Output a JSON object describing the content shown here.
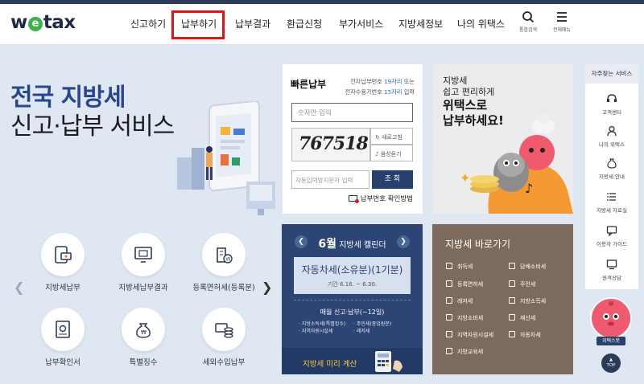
{
  "brand": {
    "logo_w": "w",
    "logo_e": "e",
    "logo_rest": "tax"
  },
  "nav": [
    "신고하기",
    "납부하기",
    "납부결과",
    "환급신청",
    "부가서비스",
    "지방세정보",
    "나의 위택스"
  ],
  "header_icons": {
    "search": "통합검색",
    "menu": "전체메뉴"
  },
  "hero": {
    "line1": "전국 지방세",
    "line2": "신고·납부 서비스"
  },
  "quick_buttons": [
    "지방세납부",
    "지방세납부결과",
    "등록면허세(등록분)",
    "납부확인서",
    "특별징수",
    "세외수입납부"
  ],
  "quick_pay": {
    "title": "빠른납부",
    "desc1_pre": "전자납부번호 ",
    "desc1_hl": "19자리",
    "desc1_post": " 또는",
    "desc2_pre": "전자수용가번호 ",
    "desc2_hl": "15자리",
    "desc2_post": " 입력",
    "input_placeholder": "숫자만 입력",
    "captcha": "767518",
    "refresh": "새로고침",
    "audio": "음성듣기",
    "captcha_placeholder": "자동입력방지문자 입력",
    "submit": "조 회",
    "confirm_link": "납부번호 확인방법"
  },
  "promo": {
    "line1": "지방세",
    "line2": "쉽고 편리하게",
    "line3": "위택스로",
    "line4": "납부하세요!"
  },
  "calendar": {
    "month": "6월",
    "title": " 지방세 캘린더",
    "tax_name": "자동차세(소유분)(1기분)",
    "period": "기간 6.16. ~ 6.30.",
    "monthly": "매월 신고·납부(~12일)",
    "items": [
      "지방소득세(특별징수)",
      "주민세(종업원분)",
      "지역자원시설세",
      "레저세"
    ],
    "calc": "지방세 미리 계산"
  },
  "shortcuts": {
    "title": "지방세 바로가기",
    "items": [
      "취득세",
      "담배소비세",
      "등록면허세",
      "주민세",
      "레저세",
      "지방소득세",
      "지방소비세",
      "재산세",
      "지역자원시설세",
      "자동차세",
      "지방교육세"
    ]
  },
  "sidebar": {
    "title": "자주찾는 서비스",
    "items": [
      "고객센터",
      "나의 위택스",
      "지방세 안내",
      "지방세 자료실",
      "이용자 가이드",
      "원격상담"
    ]
  },
  "bot_label": "위택스봇",
  "top_label": "TOP",
  "colors": {
    "navy": "#2c3a59",
    "highlight": "#e31414",
    "blue": "#27468c",
    "brown": "#7c6a5d",
    "background": "#dfe7f3"
  }
}
